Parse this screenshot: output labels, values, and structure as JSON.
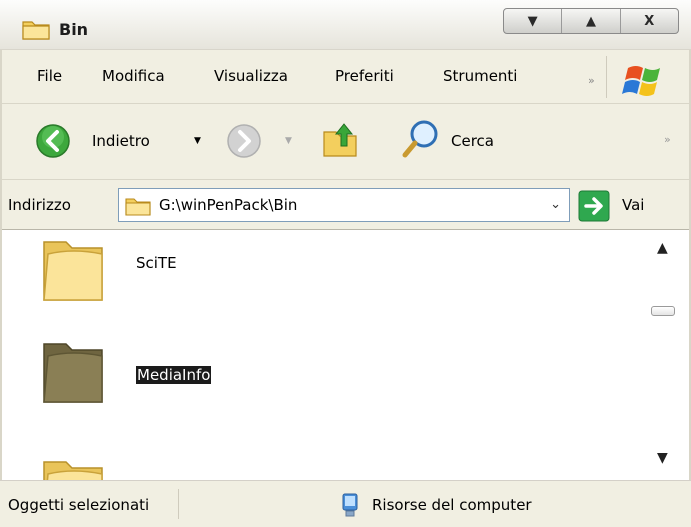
{
  "window": {
    "title": "Bin",
    "buttons": {
      "minimize": "▼",
      "maximize": "▲",
      "close": "X"
    }
  },
  "menu": {
    "items": [
      "File",
      "Modifica",
      "Visualizza",
      "Preferiti",
      "Strumenti"
    ],
    "overflow": "»"
  },
  "toolbar": {
    "back_label": "Indietro",
    "back_dropdown": "▼",
    "forward_dropdown": "▼",
    "search_label": "Cerca",
    "overflow": "»"
  },
  "address": {
    "label": "Indirizzo",
    "value": "G:\\winPenPack\\Bin",
    "dropdown": "⌄",
    "go_label": "Vai"
  },
  "files": [
    {
      "name": "SciTE",
      "selected": false,
      "icon": "folder-icon"
    },
    {
      "name": "MediaInfo",
      "selected": true,
      "icon": "folder-icon"
    },
    {
      "name": "",
      "selected": false,
      "icon": "folder-icon"
    }
  ],
  "scrollbar": {
    "up": "▲",
    "down": "▼"
  },
  "status": {
    "left": "Oggetti selezionati",
    "right": "Risorse del computer"
  },
  "colors": {
    "chrome": "#f1efe2",
    "folder_yellow": "#f5d97a",
    "folder_selected": "#7d7250",
    "go_green": "#2fa84f"
  }
}
